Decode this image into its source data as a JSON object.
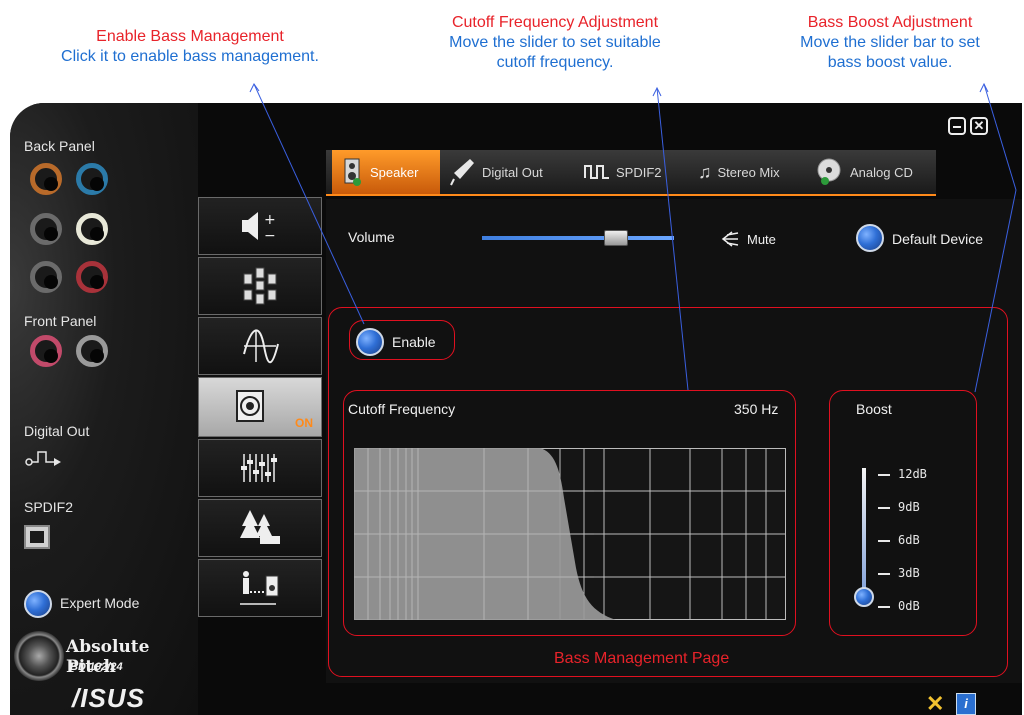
{
  "callouts": {
    "bass_mgmt": {
      "title": "Enable Bass Management",
      "desc": "Click it to enable bass management."
    },
    "cutoff": {
      "title": "Cutoff Frequency Adjustment",
      "desc_line1": "Move the slider to set suitable",
      "desc_line2": "cutoff frequency."
    },
    "boost": {
      "title": "Bass Boost Adjustment",
      "desc_line1": "Move the slider bar to set",
      "desc_line2": "bass boost value."
    }
  },
  "left_panel": {
    "back_panel": "Back Panel",
    "front_panel": "Front Panel",
    "digital_out": "Digital Out",
    "spdif2": "SPDIF2",
    "expert_mode": "Expert Mode",
    "brand_name": "Absolute Pitch",
    "brand_sub": "BD 192/24",
    "brand_logo": "/ISUS"
  },
  "tabs": [
    {
      "label": "Speaker",
      "icon": "speaker-icon"
    },
    {
      "label": "Digital Out",
      "icon": "plug-icon"
    },
    {
      "label": "SPDIF2",
      "icon": "square-wave-icon"
    },
    {
      "label": "Stereo Mix",
      "icon": "music-note-icon"
    },
    {
      "label": "Analog CD",
      "icon": "cd-icon"
    }
  ],
  "side_icons": [
    {
      "name": "volume-balance-icon"
    },
    {
      "name": "speaker-config-icon"
    },
    {
      "name": "equalizer-curve-icon"
    },
    {
      "name": "bass-management-icon",
      "badge": "ON",
      "active": true
    },
    {
      "name": "mixer-sliders-icon"
    },
    {
      "name": "environment-icon"
    },
    {
      "name": "room-correction-icon"
    }
  ],
  "header": {
    "volume_label": "Volume",
    "volume_level": 0.72,
    "mute_label": "Mute",
    "default_device_label": "Default Device"
  },
  "bass": {
    "enable_label": "Enable",
    "cutoff_label": "Cutoff Frequency",
    "cutoff_value": "350 Hz",
    "boost_label": "Boost",
    "boost_ticks": [
      "12dB",
      "9dB",
      "6dB",
      "3dB",
      "0dB"
    ],
    "boost_value_db": 0,
    "page_label": "Bass Management Page"
  },
  "colors": {
    "accent_orange": "#ff8a1a",
    "annotation_red": "#e8232a",
    "annotation_blue": "#1f6fd1"
  }
}
